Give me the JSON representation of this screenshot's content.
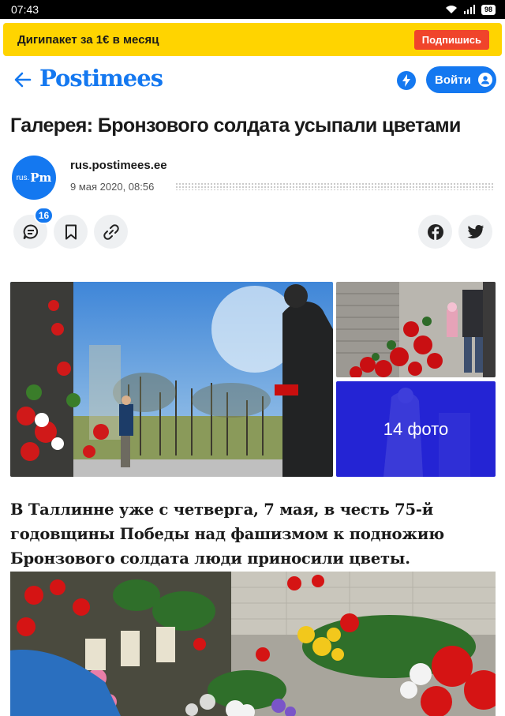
{
  "status_bar": {
    "time": "07:43",
    "battery": "98",
    "icons": [
      "wifi-icon",
      "signal-icon",
      "battery-icon"
    ]
  },
  "promo": {
    "text": "Дигипакет за 1€ в месяц",
    "button_label": "Подпишись"
  },
  "header": {
    "logo": "Postimees",
    "login_label": "Войти",
    "icons": [
      "back-arrow-icon",
      "flash-icon",
      "user-icon"
    ]
  },
  "article": {
    "title": "Галерея: Бронзового солдата усыпали цветами",
    "avatar_prefix": "rus.",
    "avatar_mark": "Pm",
    "source": "rus.postimees.ee",
    "date": "9 мая 2020, 08:56",
    "comments_count": "16",
    "gallery_count_label": "14 фото",
    "lead_lines": [
      "В Таллинне уже с четверга, 7 мая, в честь 75-й",
      "годовщины Победы над фашизмом к подножию",
      "Бронзового солдата люди приносили цветы."
    ]
  },
  "actions": {
    "left": [
      "comment-icon",
      "bookmark-icon",
      "link-icon"
    ],
    "right": [
      "facebook-icon",
      "twitter-icon"
    ]
  },
  "colors": {
    "brand_blue": "#1478f0",
    "promo_yellow": "#ffd400",
    "subscribe_red": "#f0442b"
  }
}
